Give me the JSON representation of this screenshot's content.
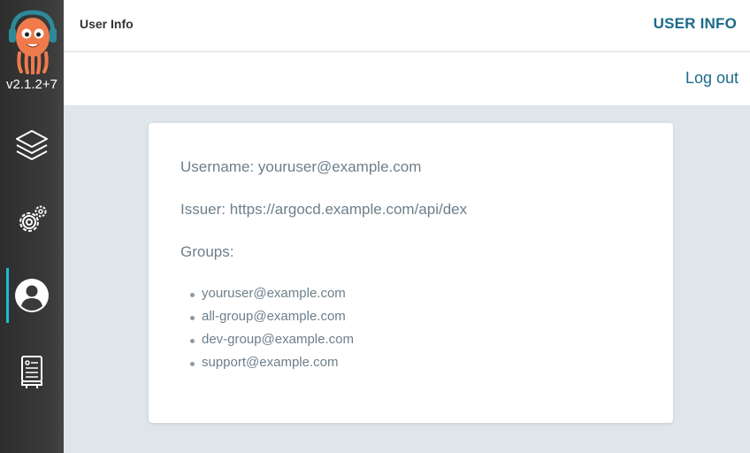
{
  "sidebar": {
    "version": "v2.1.2+7",
    "items": [
      {
        "name": "applications",
        "icon": "layers-icon"
      },
      {
        "name": "settings",
        "icon": "gears-icon"
      },
      {
        "name": "user-info",
        "icon": "user-circle-icon",
        "active": true
      },
      {
        "name": "documentation",
        "icon": "docs-book-icon"
      }
    ],
    "active_color": "#18bed0"
  },
  "header": {
    "title": "User Info",
    "section_label": "USER INFO"
  },
  "toolbar": {
    "logout_label": "Log out"
  },
  "user": {
    "username_line": "Username: youruser@example.com",
    "issuer_line": "Issuer: https://argocd.example.com/api/dex",
    "groups_label": "Groups:",
    "groups": [
      "youruser@example.com",
      "all-group@example.com",
      "dev-group@example.com",
      "support@example.com"
    ]
  },
  "colors": {
    "accent": "#1a6b8a",
    "background": "#dee6eb",
    "sidebar": "#333333"
  }
}
